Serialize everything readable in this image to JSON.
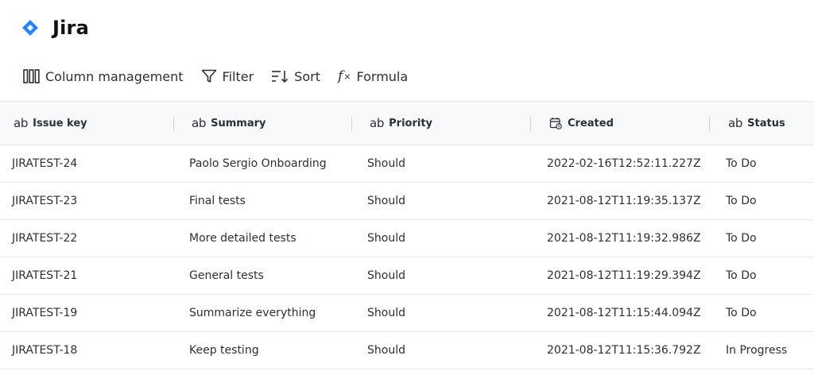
{
  "header": {
    "title": "Jira",
    "logo_icon": "jira-diamond-icon",
    "brand_color": "#2684FF"
  },
  "toolbar": {
    "column_management_label": "Column management",
    "filter_label": "Filter",
    "sort_label": "Sort",
    "formula_label": "Formula"
  },
  "table": {
    "columns": [
      {
        "label": "Issue key",
        "type_icon": "ab"
      },
      {
        "label": "Summary",
        "type_icon": "ab"
      },
      {
        "label": "Priority",
        "type_icon": "ab"
      },
      {
        "label": "Created",
        "type_icon": "calendar-icon"
      },
      {
        "label": "Status",
        "type_icon": "ab"
      }
    ],
    "rows": [
      {
        "issue_key": "JIRATEST-24",
        "summary": "Paolo Sergio Onboarding",
        "priority": "Should",
        "created": "2022-02-16T12:52:11.227Z",
        "status": "To Do"
      },
      {
        "issue_key": "JIRATEST-23",
        "summary": "Final tests",
        "priority": "Should",
        "created": "2021-08-12T11:19:35.137Z",
        "status": "To Do"
      },
      {
        "issue_key": "JIRATEST-22",
        "summary": "More detailed tests",
        "priority": "Should",
        "created": "2021-08-12T11:19:32.986Z",
        "status": "To Do"
      },
      {
        "issue_key": "JIRATEST-21",
        "summary": "General tests",
        "priority": "Should",
        "created": "2021-08-12T11:19:29.394Z",
        "status": "To Do"
      },
      {
        "issue_key": "JIRATEST-19",
        "summary": "Summarize everything",
        "priority": "Should",
        "created": "2021-08-12T11:15:44.094Z",
        "status": "To Do"
      },
      {
        "issue_key": "JIRATEST-18",
        "summary": "Keep testing",
        "priority": "Should",
        "created": "2021-08-12T11:15:36.792Z",
        "status": "In Progress"
      }
    ]
  }
}
